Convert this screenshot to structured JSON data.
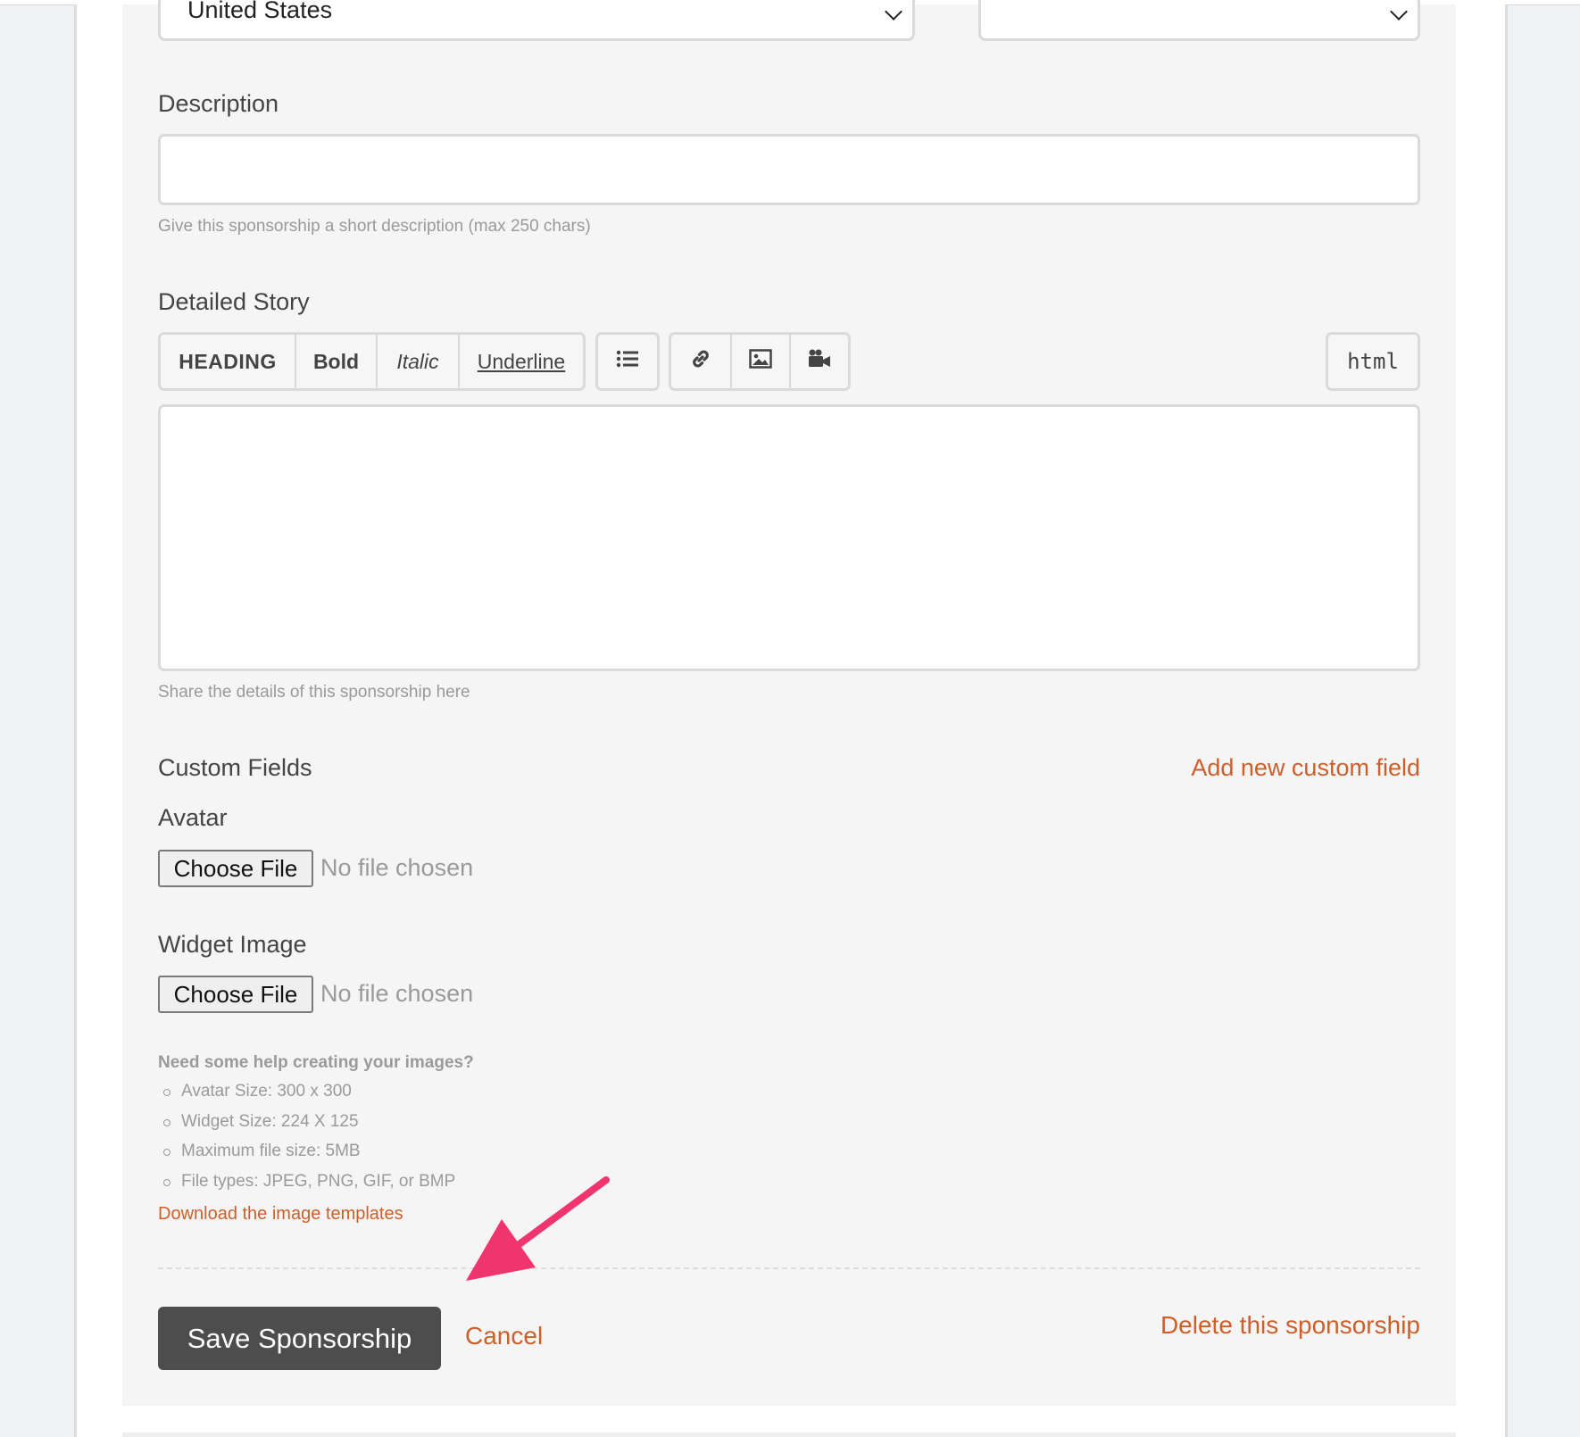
{
  "location": {
    "country_value": "United States",
    "state_value": ""
  },
  "description": {
    "label": "Description",
    "value": "",
    "help": "Give this sponsorship a short description (max 250 chars)"
  },
  "story": {
    "label": "Detailed Story",
    "toolbar": {
      "heading": "HEADING",
      "bold": "Bold",
      "italic": "Italic",
      "underline": "Underline",
      "html": "html",
      "icons": [
        "list-icon",
        "link-icon",
        "image-icon",
        "video-icon"
      ]
    },
    "value": "",
    "help": "Share the details of this sponsorship here"
  },
  "custom_fields": {
    "title": "Custom Fields",
    "add_link": "Add new custom field",
    "avatar": {
      "label": "Avatar",
      "button": "Choose File",
      "status": "No file chosen"
    },
    "widget": {
      "label": "Widget Image",
      "button": "Choose File",
      "status": "No file chosen"
    }
  },
  "image_help": {
    "title": "Need some help creating your images?",
    "items": [
      "Avatar Size: 300 x 300",
      "Widget Size: 224 X 125",
      "Maximum file size: 5MB",
      "File types: JPEG, PNG, GIF, or BMP"
    ],
    "download_link": "Download the image templates"
  },
  "actions": {
    "save": "Save Sponsorship",
    "cancel": "Cancel",
    "delete": "Delete this sponsorship"
  },
  "colors": {
    "link": "#cc5f2a",
    "annotation_arrow": "#f0356e",
    "save_button": "#4d4d4d"
  }
}
